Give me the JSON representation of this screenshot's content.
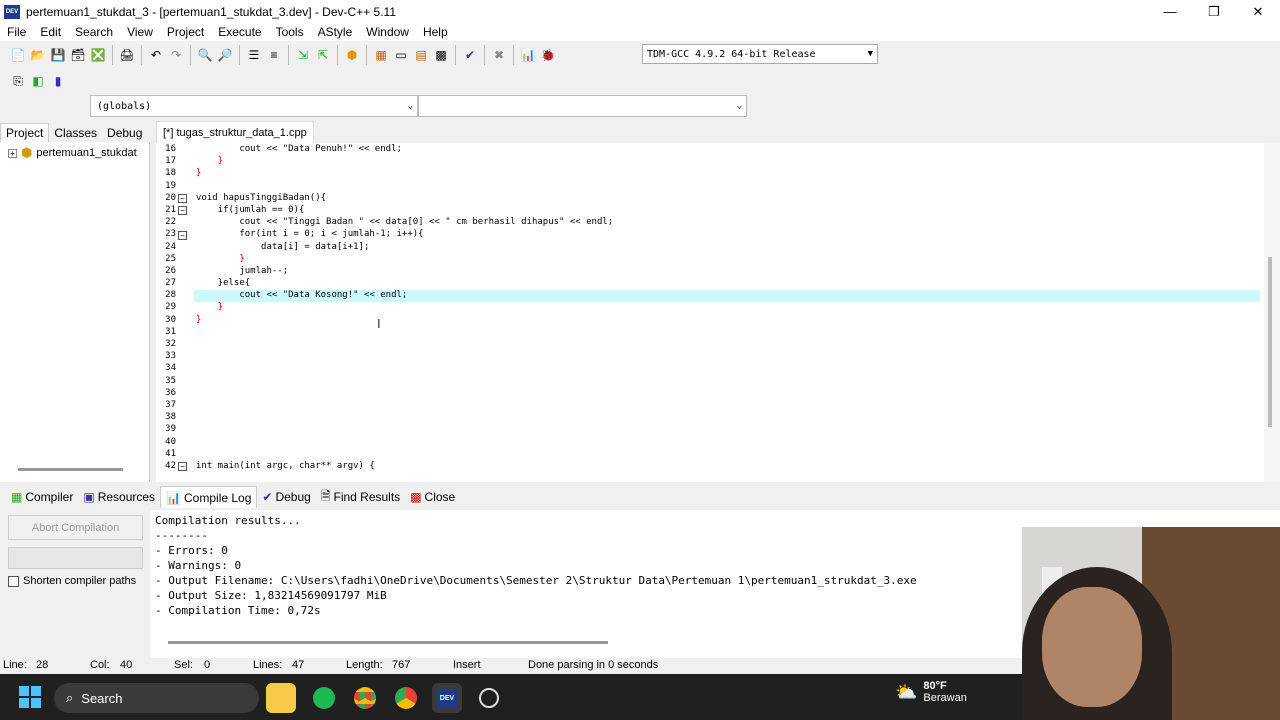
{
  "window": {
    "title": "pertemuan1_stukdat_3 - [pertemuan1_stukdat_3.dev] - Dev-C++ 5.11",
    "app_icon": "DEV"
  },
  "menu": [
    "File",
    "Edit",
    "Search",
    "View",
    "Project",
    "Execute",
    "Tools",
    "AStyle",
    "Window",
    "Help"
  ],
  "toolbar": {
    "compiler": "TDM-GCC 4.9.2 64-bit Release"
  },
  "scope": {
    "globals": "(globals)",
    "member": ""
  },
  "left_tabs": [
    "Project",
    "Classes",
    "Debug"
  ],
  "project_tree": {
    "root": "pertemuan1_stukdat"
  },
  "editor": {
    "file_tab": "[*] tugas_struktur_data_1.cpp",
    "line_numbers": [
      "16",
      "17",
      "18",
      "19",
      "20",
      "21",
      "22",
      "23",
      "24",
      "25",
      "26",
      "27",
      "28",
      "29",
      "30",
      "31",
      "32",
      "33",
      "34",
      "35",
      "36",
      "37",
      "38",
      "39",
      "40",
      "41",
      "42"
    ],
    "lines": {
      "l16": "        cout << \"Data Penuh!\" << endl;",
      "l17": "    }",
      "l18": "}",
      "l20": "void hapusTinggiBadan(){",
      "l21": "    if(jumlah == 0){",
      "l22": "        cout << \"Tinggi Badan \" << data[0] << \" cm berhasil dihapus\" << endl;",
      "l23": "        for(int i = 0; i < jumlah-1; i++){",
      "l24": "            data[i] = data[i+1];",
      "l25": "        }",
      "l26": "        jumlah--;",
      "l27": "    }else{",
      "l28": "        cout << \"Data Kosong!\" << endl;",
      "l29": "    }",
      "l30": "}",
      "l42": "int main(int argc, char** argv) {"
    }
  },
  "bottom_tabs": [
    "Compiler",
    "Resources",
    "Compile Log",
    "Debug",
    "Find Results",
    "Close"
  ],
  "compile_panel": {
    "abort_label": "Abort Compilation",
    "shorten_label": "Shorten compiler paths",
    "log": [
      "Compilation results...",
      "--------",
      "- Errors: 0",
      "- Warnings: 0",
      "- Output Filename: C:\\Users\\fadhi\\OneDrive\\Documents\\Semester 2\\Struktur Data\\Pertemuan 1\\pertemuan1_strukdat_3.exe",
      "- Output Size: 1,83214569091797 MiB",
      "- Compilation Time: 0,72s"
    ]
  },
  "status": {
    "line_label": "Line:",
    "line": "28",
    "col_label": "Col:",
    "col": "40",
    "sel_label": "Sel:",
    "sel": "0",
    "lines_label": "Lines:",
    "lines": "47",
    "length_label": "Length:",
    "length": "767",
    "mode": "Insert",
    "message": "Done parsing in 0 seconds"
  },
  "taskbar": {
    "search": "Search",
    "weather_temp": "80°F",
    "weather_desc": "Berawan"
  },
  "colors": {
    "current_line": "#ccfbff",
    "taskbar": "#202020",
    "brace_red": "#d00000"
  }
}
